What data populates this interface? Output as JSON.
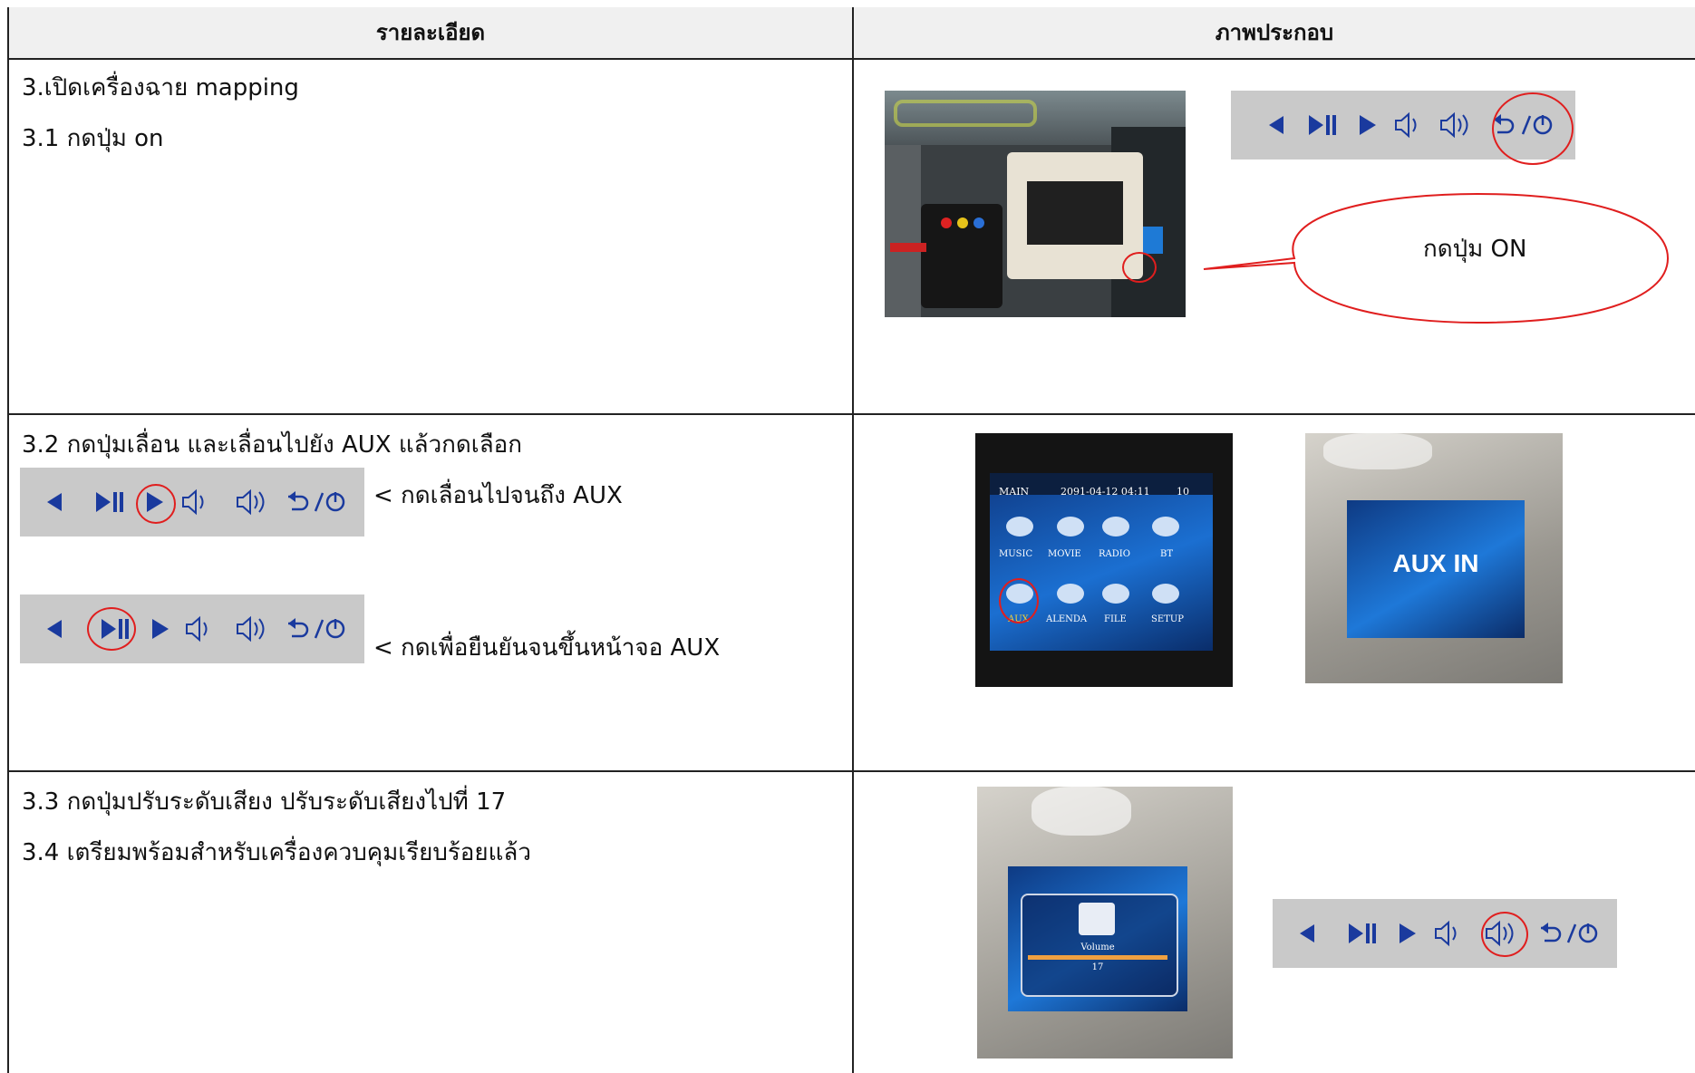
{
  "headers": {
    "details": "รายละเอียด",
    "illustration": "ภาพประกอบ"
  },
  "row1": {
    "line1": "3.เปิดเครื่องฉาย mapping",
    "line2": "3.1 กดปุ่ม on",
    "callout": "กดปุ่ม ON"
  },
  "row2": {
    "line1": "3.2 กดปุ่มเลื่อน และเลื่อนไปยัง AUX แล้วกดเลือก",
    "note1": "< กดเลื่อนไปจนถึง AUX",
    "note2": "< กดเพื่อยืนยันจนขึ้นหน้าจอ AUX",
    "screen": {
      "status": [
        "MAIN",
        "2091-04-12 04:11",
        "10"
      ],
      "menu_top": [
        "MUSIC",
        "MOVIE",
        "RADIO",
        "BT"
      ],
      "menu_bottom": [
        "AUX",
        "ALENDA",
        "FILE",
        "SETUP"
      ]
    },
    "aux_screen": "AUX IN"
  },
  "row3": {
    "line1": "3.3 กดปุ่มปรับระดับเสียง ปรับระดับเสียงไปที่ 17",
    "line2": "3.4 เตรียมพร้อมสำหรับเครื่องควบคุมเรียบร้อยแล้ว",
    "volume_label": "Volume",
    "volume_value": "17"
  },
  "colors": {
    "icon_blue": "#1a3a9e",
    "red_mark": "#e01e1e",
    "bar_gray": "#c9c9c9"
  },
  "icons": [
    "prev-icon",
    "play-pause-icon",
    "next-icon",
    "volume-down-icon",
    "volume-up-icon",
    "back-power-icon"
  ]
}
